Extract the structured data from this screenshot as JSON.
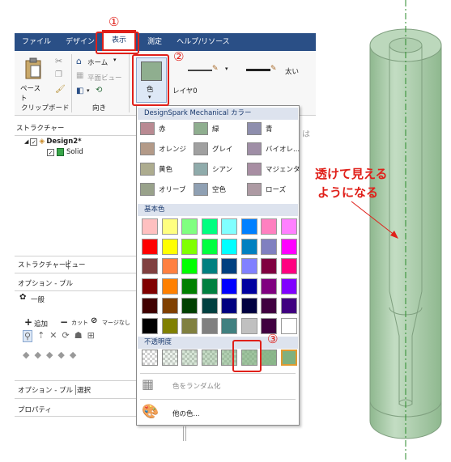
{
  "tabs": [
    {
      "label": "ファイル"
    },
    {
      "label": "デザイン"
    },
    {
      "label": "表示",
      "active": true
    },
    {
      "label": "測定"
    },
    {
      "label": "ヘルプ/リソース"
    }
  ],
  "ribbon": {
    "paste_label": "ペースト",
    "clipboard_label": "クリップボード",
    "home_label": "ホーム",
    "plan_view_label": "平面ビュー",
    "orient_label": "向き",
    "color_label": "色",
    "layer_label": "レイヤ0",
    "thick_label": "太い"
  },
  "left_panel": {
    "structure_title": "ストラクチャー",
    "design_name": "Design2*",
    "solid_name": "Solid",
    "tab_structure": "ストラクチャー",
    "tab_view": "ビュー",
    "options_title": "オプション - プル",
    "general_label": "一般",
    "add_label": "追加",
    "cut_label": "カット",
    "no_merge_label": "マージなし",
    "tab_options": "オプション - プル",
    "tab_select": "選択",
    "properties_label": "プロパティ",
    "faded_text": "は"
  },
  "dropdown": {
    "header_dsm": "DesignSpark Mechanical カラー",
    "named_colors": [
      {
        "name": "赤",
        "color": "#b98a92"
      },
      {
        "name": "緑",
        "color": "#8fae8f"
      },
      {
        "name": "青",
        "color": "#8e8ead"
      },
      {
        "name": "オレンジ",
        "color": "#b39a88"
      },
      {
        "name": "グレイ",
        "color": "#a0a0a0"
      },
      {
        "name": "バイオレ...",
        "color": "#9f8ea6"
      },
      {
        "name": "黄色",
        "color": "#adac8f"
      },
      {
        "name": "シアン",
        "color": "#8fabab"
      },
      {
        "name": "マジェンタ",
        "color": "#a88ea3"
      },
      {
        "name": "オリーブ",
        "color": "#99a28b"
      },
      {
        "name": "空色",
        "color": "#8fa0b3"
      },
      {
        "name": "ローズ",
        "color": "#ad9aa3"
      }
    ],
    "header_basic": "基本色",
    "basic_colors": [
      "#ffc0c0",
      "#ffff80",
      "#80ff80",
      "#00ff80",
      "#80ffff",
      "#0080ff",
      "#ff80c0",
      "#ff80ff",
      "#ff0000",
      "#ffff00",
      "#80ff00",
      "#00ff40",
      "#00ffff",
      "#0080c0",
      "#8080c0",
      "#ff00ff",
      "#804040",
      "#ff8040",
      "#00ff00",
      "#008080",
      "#004080",
      "#8080ff",
      "#800040",
      "#ff0080",
      "#800000",
      "#ff8000",
      "#008000",
      "#008040",
      "#0000ff",
      "#0000a0",
      "#800080",
      "#8000ff",
      "#400000",
      "#804000",
      "#004000",
      "#004040",
      "#000080",
      "#000040",
      "#400040",
      "#400080",
      "#000000",
      "#808000",
      "#808040",
      "#808080",
      "#408080",
      "#c0c0c0",
      "#400040",
      "#ffffff"
    ],
    "header_opacity": "不透明度",
    "opacity_levels": [
      0,
      0.15,
      0.3,
      0.45,
      0.6,
      0.75,
      0.9,
      1.0
    ],
    "random_label": "色をランダム化",
    "other_label": "他の色..."
  },
  "annotations": {
    "num1": "①",
    "num2": "②",
    "num3": "③",
    "note_line1": "透けて見える",
    "note_line2": "ようになる"
  },
  "colors": {
    "accent_red": "#e0201a",
    "tab_blue": "#2a4f86",
    "cylinder_green": "#a9cfa9"
  }
}
